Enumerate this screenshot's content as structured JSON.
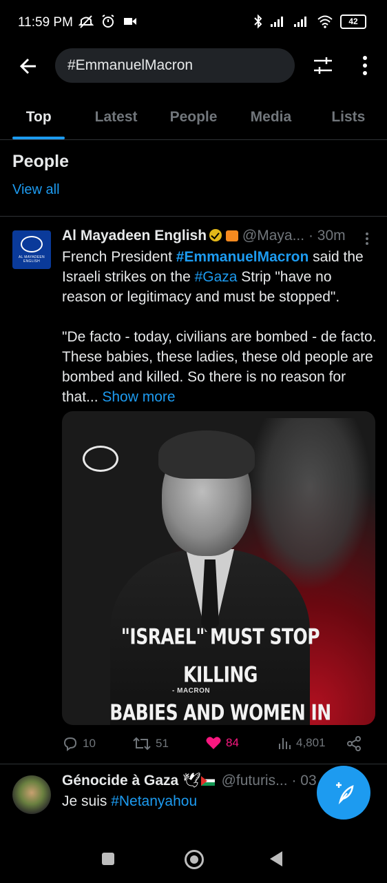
{
  "status_bar": {
    "time": "11:59 PM",
    "battery": "42",
    "left_icons": [
      "mute-icon",
      "alarm-icon",
      "video-icon"
    ],
    "right_icons": [
      "bluetooth-icon",
      "signal-icon",
      "signal-icon",
      "wifi-icon",
      "battery-icon"
    ]
  },
  "header": {
    "search_value": "#EmmanuelMacron",
    "icons": [
      "back-arrow-icon",
      "filter-icon",
      "more-vertical-icon"
    ]
  },
  "tabs": [
    {
      "label": "Top",
      "active": true
    },
    {
      "label": "Latest",
      "active": false
    },
    {
      "label": "People",
      "active": false
    },
    {
      "label": "Media",
      "active": false
    },
    {
      "label": "Lists",
      "active": false
    }
  ],
  "people_section": {
    "title": "People",
    "view_all": "View all"
  },
  "tweet1": {
    "name": "Al Mayadeen English",
    "handle": "@Maya...",
    "time": "· 30m",
    "avatar_lines": [
      "AL MAYADEEN",
      "ENGLISH"
    ],
    "text_parts": {
      "p1_a": "French President ",
      "p1_hash1": "#EmmanuelMacron",
      "p1_b": " said the Israeli strikes on the ",
      "p1_hash2": "#Gaza",
      "p1_c": " Strip \"have no reason or legitimacy and must be stopped\".",
      "p2": "\"De facto - today, civilians are bombed - de facto. These babies, these ladies, these old people are bombed and killed. So there is no reason for that... ",
      "show_more": "Show more"
    },
    "media": {
      "quote_line1": "\"ISRAEL\" MUST STOP KILLING",
      "quote_line2": "BABIES AND WOMEN IN GAZA",
      "attribution": "- MACRON"
    },
    "actions": {
      "replies": "10",
      "retweets": "51",
      "likes": "84",
      "views": "4,801"
    },
    "colors": {
      "like": "#f91880",
      "link": "#1d9bf0",
      "verified": "#e2b719"
    }
  },
  "tweet2": {
    "name": "Génocide à Gaza",
    "handle": "@futuris...",
    "time": "· 03",
    "text_a": "Je suis ",
    "text_hash": "#Netanyahou"
  },
  "fab": {
    "icon": "compose-feather-icon"
  },
  "nav": {
    "icons": [
      "recents-square-icon",
      "home-circle-icon",
      "back-triangle-icon"
    ]
  }
}
